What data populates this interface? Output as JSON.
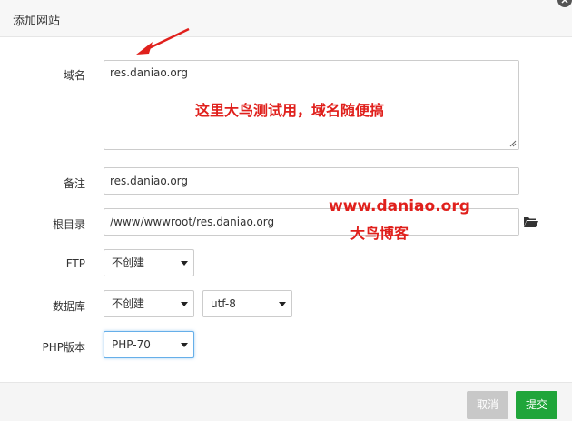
{
  "dialog": {
    "title": "添加网站"
  },
  "form": {
    "domain": {
      "label": "域名",
      "value": "res.daniao.org"
    },
    "remark": {
      "label": "备注",
      "value": "res.daniao.org"
    },
    "root": {
      "label": "根目录",
      "value": "/www/wwwroot/res.daniao.org"
    },
    "ftp": {
      "label": "FTP",
      "selected": "不创建"
    },
    "database": {
      "label": "数据库",
      "selected": "不创建",
      "charset": "utf-8"
    },
    "php": {
      "label": "PHP版本",
      "selected": "PHP-70"
    }
  },
  "annotations": {
    "note": "这里大鸟测试用，域名随便搞",
    "site": "www.daniao.org",
    "blog": "大鸟博客"
  },
  "footer": {
    "cancel_label": "取消",
    "submit_label": "提交"
  },
  "colors": {
    "submit": "#20a53a",
    "cancel": "#c8c8c8",
    "annotation": "#e0201c"
  },
  "icons": [
    "close-icon",
    "folder-icon",
    "resize-grip-icon",
    "caret-down-icon",
    "arrow-annotation"
  ]
}
